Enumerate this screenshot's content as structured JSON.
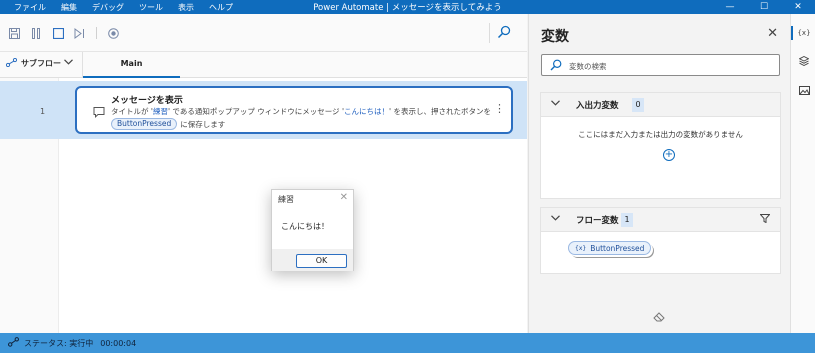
{
  "app": {
    "window_title": "Power Automate | メッセージを表示してみよう",
    "menu": [
      "ファイル",
      "編集",
      "デバッグ",
      "ツール",
      "表示",
      "ヘルプ"
    ],
    "window_controls": [
      "—",
      "☐",
      "✕"
    ]
  },
  "toolbar": {
    "icons": [
      "save-icon",
      "pause-icon",
      "stop-icon",
      "step-icon",
      "record-icon",
      "search-icon"
    ]
  },
  "tabs": {
    "subflow_label": "サブフロー",
    "main_label": "Main"
  },
  "action": {
    "row_number": "1",
    "title": "メッセージを表示",
    "desc_prefix": "タイトルが '",
    "desc_title_value": "練習",
    "desc_middle": "' である通知ポップアップ ウィンドウにメッセージ '",
    "desc_message_value": "こんにちは！",
    "desc_suffix": "' を表示し、押されたボタンを",
    "output_variable": "ButtonPressed",
    "desc_end": "に保存します"
  },
  "dialog": {
    "title": "練習",
    "message": "こんにちは！",
    "ok_label": "OK"
  },
  "variables_panel": {
    "title": "変数",
    "search_placeholder": "変数の検索",
    "io_section": {
      "label": "入出力変数",
      "count": "0",
      "empty_text": "ここにはまだ入力または出力の変数がありません"
    },
    "flow_section": {
      "label": "フロー変数",
      "count": "1",
      "variables": [
        "ButtonPressed"
      ]
    }
  },
  "status": {
    "label": "ステータス: 実行中",
    "elapsed": "00:00:04"
  },
  "colors": {
    "accent": "#0f6cbd",
    "status_bar": "#3d95d8",
    "selected_row": "#cfe3f7"
  }
}
